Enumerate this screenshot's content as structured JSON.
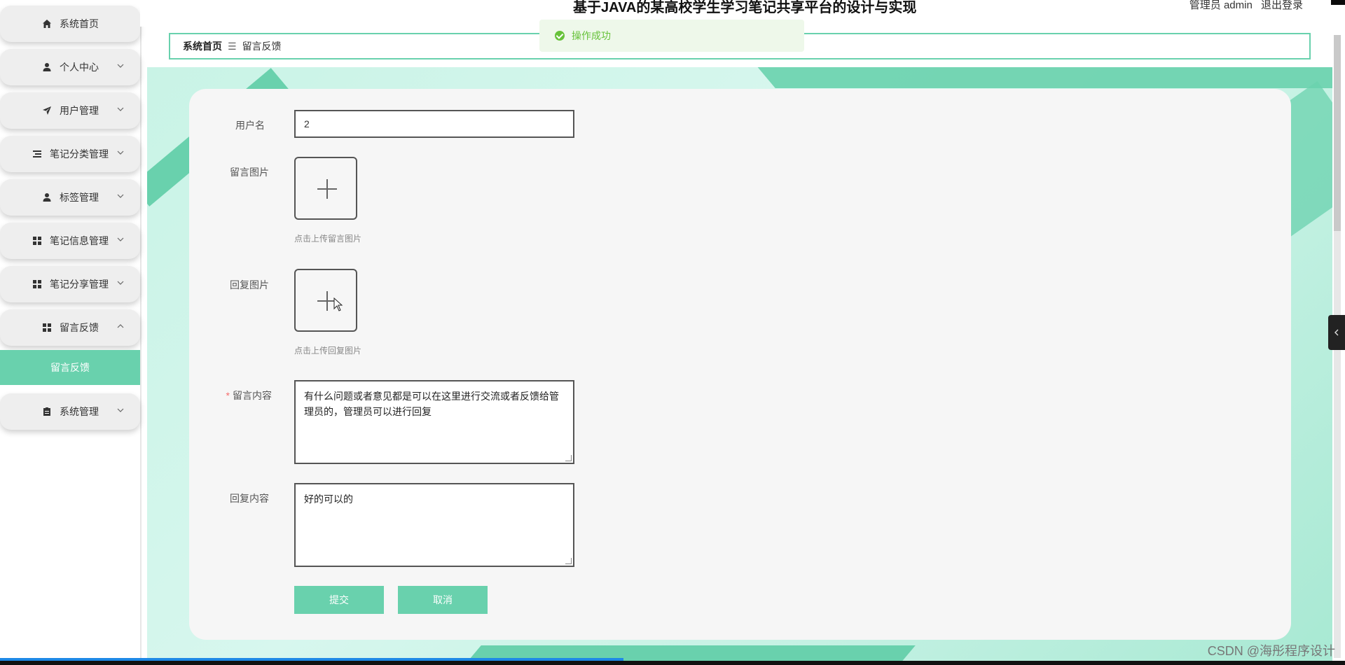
{
  "header": {
    "title": "基于JAVA的某高校学生学习笔记共享平台的设计与实现",
    "role_label": "管理员 admin",
    "logout_label": "退出登录"
  },
  "toast": {
    "message": "操作成功"
  },
  "sidebar": {
    "items": [
      {
        "label": "系统首页",
        "icon": "home-icon"
      },
      {
        "label": "个人中心",
        "icon": "user-icon"
      },
      {
        "label": "用户管理",
        "icon": "send-icon"
      },
      {
        "label": "笔记分类管理",
        "icon": "list-icon"
      },
      {
        "label": "标签管理",
        "icon": "person-icon"
      },
      {
        "label": "笔记信息管理",
        "icon": "grid-icon"
      },
      {
        "label": "笔记分享管理",
        "icon": "grid-icon"
      },
      {
        "label": "留言反馈",
        "icon": "grid-icon"
      },
      {
        "label": "系统管理",
        "icon": "clipboard-icon"
      }
    ],
    "active_sub": "留言反馈"
  },
  "breadcrumb": {
    "home": "系统首页",
    "separator": "☰",
    "current": "留言反馈"
  },
  "form": {
    "username": {
      "label": "用户名",
      "value": "2"
    },
    "message_image": {
      "label": "留言图片",
      "hint": "点击上传留言图片"
    },
    "reply_image": {
      "label": "回复图片",
      "hint": "点击上传回复图片"
    },
    "message_content": {
      "required": "*",
      "label": "留言内容",
      "value": "有什么问题或者意见都是可以在这里进行交流或者反馈给管理员的，管理员可以进行回复"
    },
    "reply_content": {
      "label": "回复内容",
      "value": "好的可以的"
    },
    "submit_label": "提交",
    "cancel_label": "取消"
  },
  "watermark": "CSDN @海彤程序设计",
  "colors": {
    "accent": "#69d1ad",
    "toast_text": "#67c23a",
    "toast_bg": "#eef8ea"
  }
}
